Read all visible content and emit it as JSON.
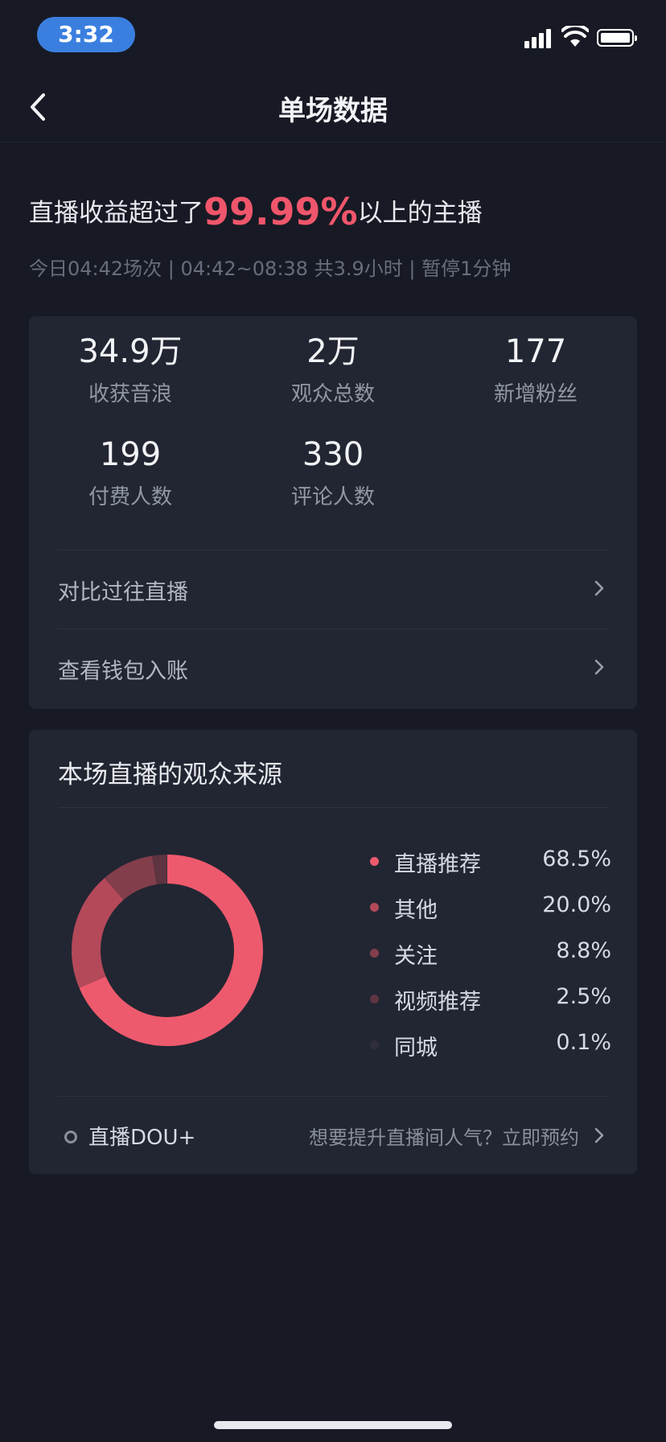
{
  "status_bar": {
    "time": "3:32"
  },
  "nav": {
    "title": "单场数据"
  },
  "headline": {
    "prefix": "直播收益超过了",
    "percent": "99.99%",
    "suffix": "以上的主播",
    "subline": "今日04:42场次 | 04:42~08:38 共3.9小时 | 暂停1分钟"
  },
  "stats": [
    {
      "value": "34.9万",
      "label": "收获音浪"
    },
    {
      "value": "2万",
      "label": "观众总数"
    },
    {
      "value": "177",
      "label": "新增粉丝"
    },
    {
      "value": "199",
      "label": "付费人数"
    },
    {
      "value": "330",
      "label": "评论人数"
    }
  ],
  "links": [
    {
      "label": "对比过往直播"
    },
    {
      "label": "查看钱包入账"
    }
  ],
  "source": {
    "title": "本场直播的观众来源",
    "legend": [
      {
        "name": "直播推荐",
        "pct": "68.5%",
        "value": 68.5,
        "color": "#ee5a6d"
      },
      {
        "name": "其他",
        "pct": "20.0%",
        "value": 20.0,
        "color": "#b4495a"
      },
      {
        "name": "关注",
        "pct": "8.8%",
        "value": 8.8,
        "color": "#833e4c"
      },
      {
        "name": "视频推荐",
        "pct": "2.5%",
        "value": 2.5,
        "color": "#5e3441"
      },
      {
        "name": "同城",
        "pct": "0.1%",
        "value": 0.1,
        "color": "#2f2e3a"
      }
    ],
    "footer_left": "直播DOU+",
    "footer_right": "想要提升直播间人气？立即预约"
  },
  "chart_data": {
    "type": "pie",
    "categories": [
      "直播推荐",
      "其他",
      "关注",
      "视频推荐",
      "同城"
    ],
    "values": [
      68.5,
      20.0,
      8.8,
      2.5,
      0.1
    ]
  }
}
